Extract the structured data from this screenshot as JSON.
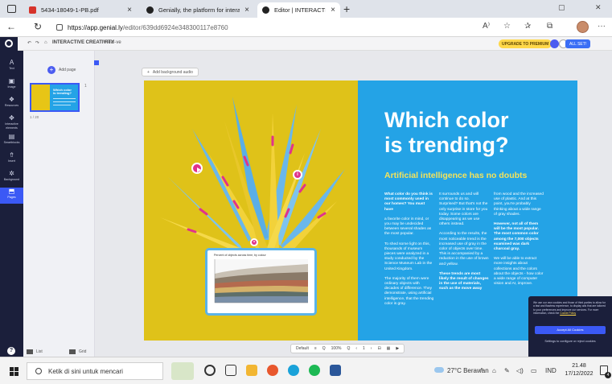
{
  "browser": {
    "tabs": [
      {
        "title": "5434-18049-1-PB.pdf",
        "favicon_color": "#d6332b",
        "active": false
      },
      {
        "title": "Genially, the platform for interac",
        "favicon_color": "#222222",
        "active": false
      },
      {
        "title": "Editor | INTERACTIVE CREATIVITY",
        "favicon_color": "#222222",
        "active": true
      }
    ],
    "new_tab": "+",
    "url_domain": "https://app.genial.ly",
    "url_path": "/editor/639dd6924e348300117e8760"
  },
  "editor": {
    "project_name": "INTERACTIVE CREATIVITY",
    "view_label": "Real-ve",
    "upgrade_label": "UPGRADE TO PREMIUM",
    "all_set_label": "ALL SET!",
    "sidebar": [
      {
        "icon": "A",
        "label": "Text"
      },
      {
        "icon": "▣",
        "label": "Image"
      },
      {
        "icon": "❖",
        "label": "Resources"
      },
      {
        "icon": "✥",
        "label": "Interactive elements"
      },
      {
        "icon": "▤",
        "label": "Smartblocks"
      },
      {
        "icon": "⇮",
        "label": "Insert"
      },
      {
        "icon": "✲",
        "label": "Background"
      },
      {
        "icon": "⬒",
        "label": "Pages"
      }
    ],
    "add_page_label": "Add page",
    "page_number": "1 / 20",
    "page_badge": "1",
    "bottom_tabs": [
      "List",
      "Grid"
    ],
    "background_audio_label": "Add background audio"
  },
  "slide": {
    "title": "Which color\nis trending?",
    "subtitle": "Artificial intelligence has no doubts",
    "columns": [
      [
        {
          "text": "What color do you think is most commonly used in our homes? You must have",
          "bold": true
        },
        {
          "text": "a favorite color in mind, or you may be undecided between several shades as the most popular.",
          "bold": false
        },
        {
          "text": "To shed some light on this, thousands of museum pieces were analyzed in a study conducted by the Science Museum Lab in the United Kingdom.",
          "bold": false
        },
        {
          "text": "The majority of them were ordinary objects with decades of difference. They demonstrate, using artificial intelligence, that the trending color is gray.",
          "bold": false
        }
      ],
      [
        {
          "text": "It surrounds us and will continue to do so. Surprised? But that's not the only surprise in store for you today. Some colors are disappearing as we use others instead.",
          "bold": false
        },
        {
          "text": "According to the results, the most noticeable trend is the increased use of gray in the color of objects over time. This is accompanied by a reduction in the use of brown and yellow.",
          "bold": false
        },
        {
          "text": "These trends are most likely the result of changes in the use of materials, such as the move away",
          "bold": true
        }
      ],
      [
        {
          "text": "from wood and the increased use of plastic. And at this point, you're probably thinking about a wide range of gray shades.",
          "bold": false
        },
        {
          "text": "However, not all of them will be the most popular. The most common color among the 7,000 objects examined was dark charcoal gray.",
          "bold": true
        },
        {
          "text": "We will be able to extract more insights about collections and the colors about the objects - how color a wide range of computer vision and AI, improve.",
          "bold": false
        }
      ]
    ],
    "chart_title": "Percent of objects across time, by colour"
  },
  "toolbar": {
    "items": [
      "Default",
      "≡",
      "Q",
      "100%",
      "Q",
      "‹",
      "1",
      "›",
      "⊟",
      "▦",
      "▶"
    ]
  },
  "cookie": {
    "text": "We use our own cookies and those of third parties to allow for a fast and flawless experience, to display ads that are tailored to your preferences and improve our services. For more information, check the",
    "link": "Cookie Policy",
    "accept": "Accept All Cookies",
    "settings": "Settings to configure or reject cookies"
  },
  "taskbar": {
    "search_placeholder": "Ketik di sini untuk mencari",
    "weather": "27°C  Berawan",
    "language": "IND",
    "time": "21.48",
    "date": "17/12/2022",
    "notification_count": "4"
  }
}
